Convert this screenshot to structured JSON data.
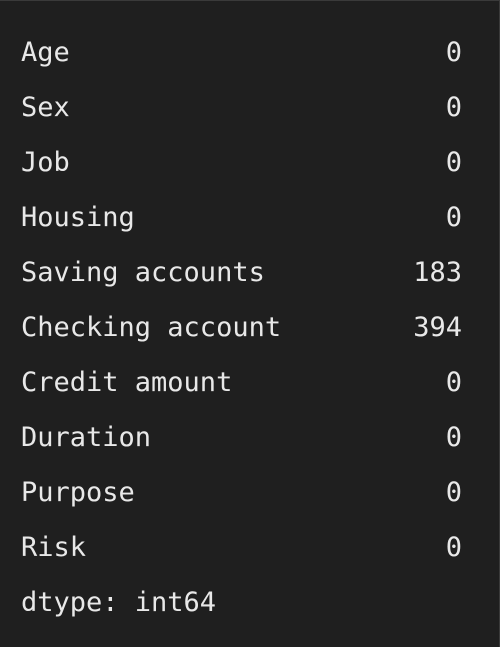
{
  "series_output": {
    "rows": [
      {
        "label": "Age",
        "value": "0"
      },
      {
        "label": "Sex",
        "value": "0"
      },
      {
        "label": "Job",
        "value": "0"
      },
      {
        "label": "Housing",
        "value": "0"
      },
      {
        "label": "Saving accounts",
        "value": "183"
      },
      {
        "label": "Checking account",
        "value": "394"
      },
      {
        "label": "Credit amount",
        "value": "0"
      },
      {
        "label": "Duration",
        "value": "0"
      },
      {
        "label": "Purpose",
        "value": "0"
      },
      {
        "label": "Risk",
        "value": "0"
      }
    ],
    "dtype_line": "dtype: int64"
  }
}
